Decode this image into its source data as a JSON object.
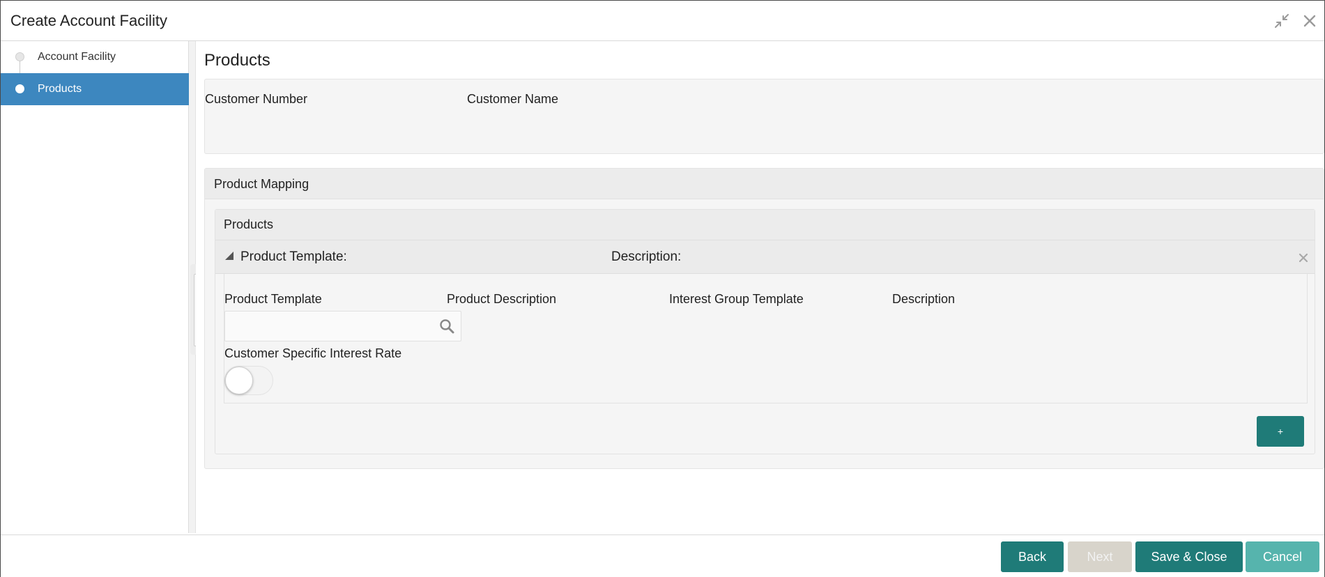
{
  "window": {
    "title": "Create Account Facility"
  },
  "sidebar": {
    "items": [
      {
        "label": "Account Facility",
        "active": false
      },
      {
        "label": "Products",
        "active": true
      }
    ]
  },
  "main": {
    "page_title": "Products",
    "customer": {
      "number_label": "Customer Number",
      "name_label": "Customer Name"
    },
    "product_mapping": {
      "title": "Product Mapping",
      "products_title": "Products",
      "record": {
        "template_label": "Product Template:",
        "description_label": "Description:"
      },
      "fields": {
        "product_template": "Product Template",
        "product_description": "Product Description",
        "interest_group_template": "Interest Group Template",
        "description": "Description",
        "product_template_value": "",
        "customer_specific_interest_rate": "Customer Specific Interest Rate",
        "customer_specific_interest_rate_on": false
      },
      "add_button": "+"
    }
  },
  "footer": {
    "back": "Back",
    "next": "Next",
    "save_close": "Save & Close",
    "cancel": "Cancel"
  },
  "colors": {
    "primary_button": "#1f7b78",
    "cancel_button": "#56b4ad",
    "disabled_button": "#d8d4cb",
    "sidebar_active": "#3d87bf"
  }
}
